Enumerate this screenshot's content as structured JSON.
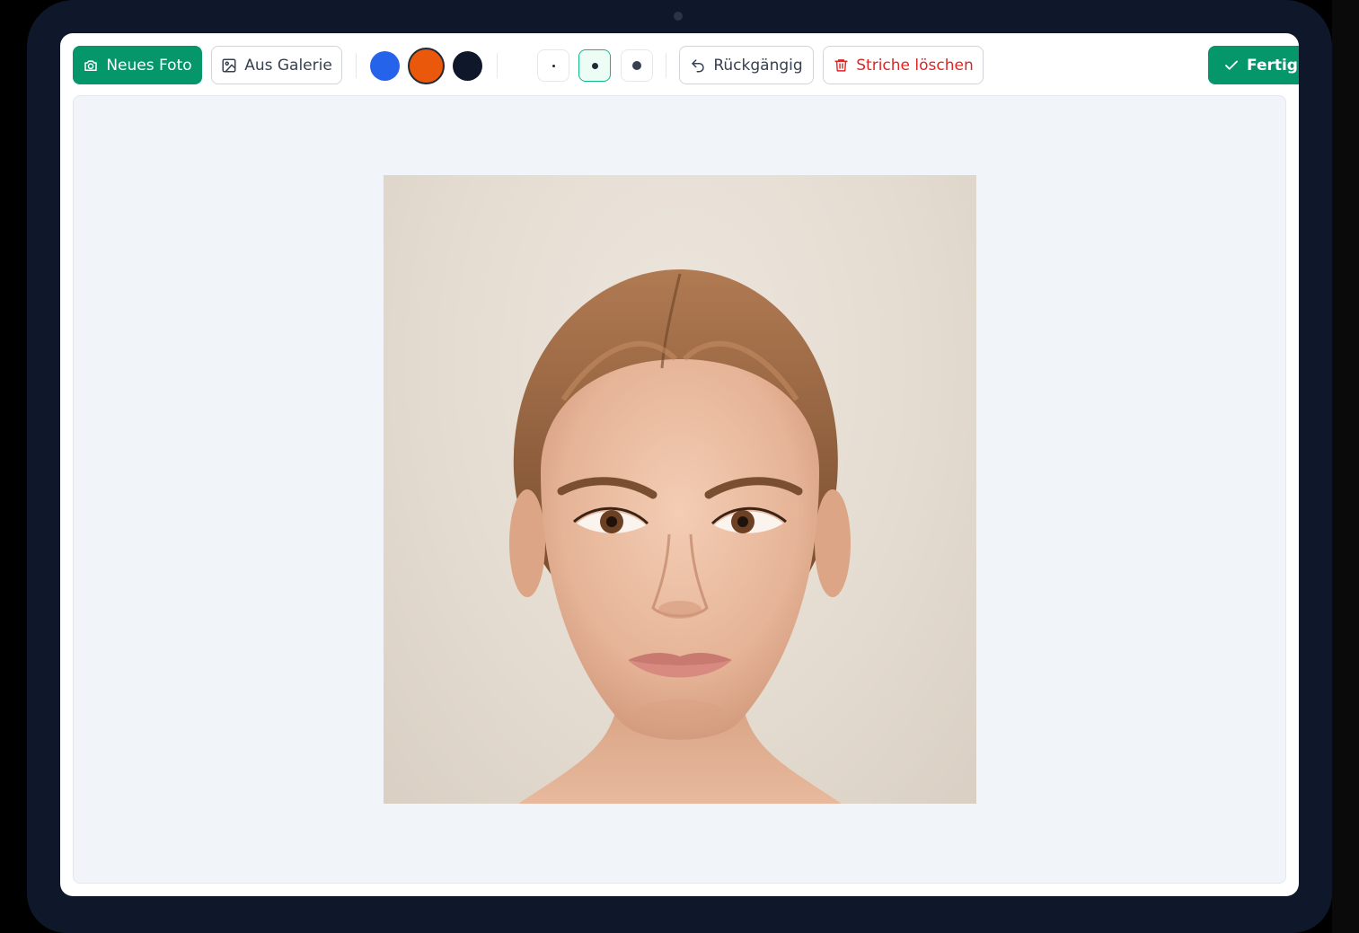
{
  "toolbar": {
    "new_photo_label": "Neues Foto",
    "gallery_label": "Aus Galerie",
    "undo_label": "Rückgängig",
    "clear_label": "Striche löschen",
    "done_label": "Fertig"
  },
  "colors": {
    "accent": "#059669",
    "danger": "#dc2626",
    "swatches": [
      "#2563eb",
      "#ea580c",
      "#0f172a"
    ],
    "selected_swatch_index": 1
  },
  "brush_sizes": {
    "selected_index": 1
  },
  "icons": {
    "new_photo": "camera-icon",
    "gallery": "image-icon",
    "undo": "undo-icon",
    "clear": "trash-icon",
    "done": "check-icon"
  }
}
